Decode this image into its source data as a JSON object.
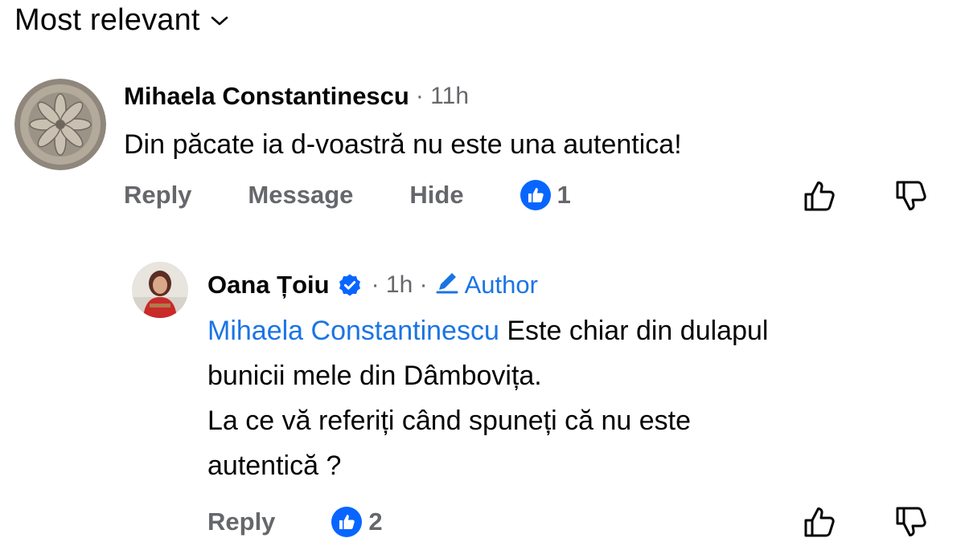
{
  "sort": {
    "label": "Most relevant",
    "icon": "chevron-down-icon"
  },
  "colors": {
    "link": "#1b74e4",
    "muted": "#65676b",
    "text": "#050505",
    "like": "#0866ff"
  },
  "comments": [
    {
      "author": "Mihaela Constantinescu",
      "meta": "· 11h",
      "text": "Din păcate ia d-voastră nu este una autentica!",
      "actions": {
        "reply": "Reply",
        "message": "Message",
        "hide": "Hide"
      },
      "reaction_count": "1"
    }
  ],
  "reply": {
    "author": "Oana Țoiu",
    "verified": true,
    "meta": "· 1h ·",
    "badge": "Author",
    "mention": "Mihaela Constantinescu",
    "lines": [
      "Este chiar din dulapul",
      "bunicii mele din Dâmbovița.",
      "La ce vă referiți când spuneți că nu este",
      "autentică ?"
    ],
    "actions": {
      "reply": "Reply"
    },
    "reaction_count": "2"
  }
}
